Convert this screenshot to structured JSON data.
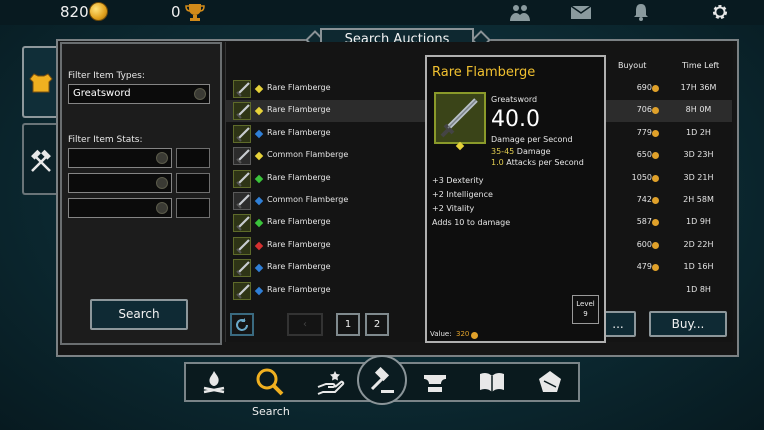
{
  "topbar": {
    "gold": "820",
    "trophies": "0",
    "icons": [
      "coin-icon",
      "trophy-icon",
      "friends-icon",
      "mail-icon",
      "bell-icon",
      "gear-icon"
    ]
  },
  "window_title": "Search Auctions",
  "filter": {
    "types_label": "Filter Item Types:",
    "type_selected": "Greatsword",
    "stats_label": "Filter Item Stats:",
    "search_label": "Search"
  },
  "columns": {
    "buyout": "Buyout",
    "time_left": "Time Left"
  },
  "items": [
    {
      "name": "Rare Flamberge",
      "gem": "#e6d23a",
      "rarity": "rare",
      "buyout": "690",
      "time": "17H 36M"
    },
    {
      "name": "Rare Flamberge",
      "gem": "#e6d23a",
      "rarity": "rare",
      "buyout": "706",
      "time": "8H 0M"
    },
    {
      "name": "Rare Flamberge",
      "gem": "#2f7fd6",
      "rarity": "rare",
      "buyout": "779",
      "time": "1D 2H"
    },
    {
      "name": "Common Flamberge",
      "gem": "#e6d23a",
      "rarity": "common",
      "buyout": "650",
      "time": "3D 23H"
    },
    {
      "name": "Rare Flamberge",
      "gem": "#3bc43b",
      "rarity": "rare",
      "buyout": "1050",
      "time": "3D 21H"
    },
    {
      "name": "Common Flamberge",
      "gem": "#2f7fd6",
      "rarity": "common",
      "buyout": "742",
      "time": "2H 58M"
    },
    {
      "name": "Rare Flamberge",
      "gem": "#3bc43b",
      "rarity": "rare",
      "buyout": "587",
      "time": "1D 9H"
    },
    {
      "name": "Rare Flamberge",
      "gem": "#d43030",
      "rarity": "rare",
      "buyout": "600",
      "time": "2D 22H"
    },
    {
      "name": "Rare Flamberge",
      "gem": "#2f7fd6",
      "rarity": "rare",
      "buyout": "479",
      "time": "1D 16H"
    },
    {
      "name": "Rare Flamberge",
      "gem": "#2f7fd6",
      "rarity": "rare",
      "buyout": "",
      "time": "1D 8H"
    }
  ],
  "pagination": {
    "page1": "1",
    "page2": "2"
  },
  "buy_label": "Buy...",
  "bid_label": "...",
  "tooltip": {
    "title": "Rare Flamberge",
    "type": "Greatsword",
    "dps": "40.0",
    "dps_label": "Damage per Second",
    "damage_range": "35-45",
    "damage_word": "Damage",
    "attacks_value": "1.0",
    "attacks_word": "Attacks per Second",
    "stats": [
      "+3 Dexterity",
      "+2 Intelligence",
      "+2 Vitality",
      "Adds 10 to damage"
    ],
    "level_label": "Level",
    "level_value": "9",
    "value_label": "Value:",
    "value_amount": "320"
  },
  "bottom_nav": {
    "active_label": "Search",
    "icons": [
      "campfire-icon",
      "search-icon",
      "sell-icon",
      "auction-gavel-icon",
      "anvil-icon",
      "book-icon",
      "map-icon"
    ]
  }
}
